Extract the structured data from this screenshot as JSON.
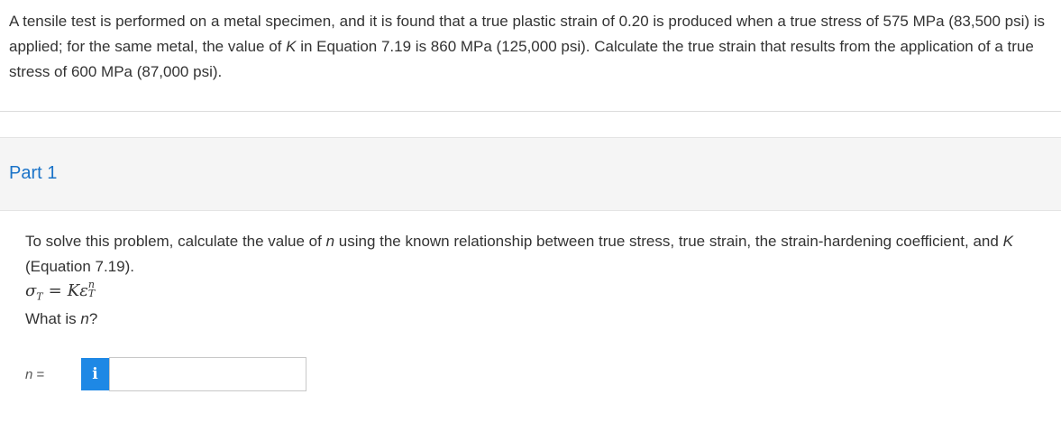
{
  "question": {
    "text_1": "A tensile test is performed on a metal specimen, and it is found that a true plastic strain of 0.20 is produced when a true stress of 575 MPa (83,500 psi) is applied; for the same metal, the value of ",
    "var_k": "K",
    "text_2": " in Equation 7.19 is 860 MPa (125,000 psi). Calculate the true strain that results from the application of a true stress of 600 MPa (87,000 psi)."
  },
  "part": {
    "title": "Part 1",
    "instruction_1": "To solve this problem, calculate the value of ",
    "var_n": "n",
    "instruction_2": " using the known relationship between true stress, true strain, the strain-hardening coefficient, and ",
    "var_k": "K",
    "instruction_3": " (Equation 7.19).",
    "equation": {
      "lhs": "σ",
      "lhs_sub": "T",
      "eq": "=",
      "rhs_k": "K",
      "rhs_eps": "ε",
      "rhs_sup": "n",
      "rhs_sub": "T"
    },
    "prompt_1": "What is ",
    "prompt_var": "n",
    "prompt_2": "?"
  },
  "answer": {
    "label_var": "n",
    "label_eq": " =",
    "info_icon": "info-icon",
    "value": ""
  },
  "colors": {
    "part_title": "#1a73c8",
    "info_button": "#1e88e5",
    "header_bg": "#f5f5f5"
  }
}
